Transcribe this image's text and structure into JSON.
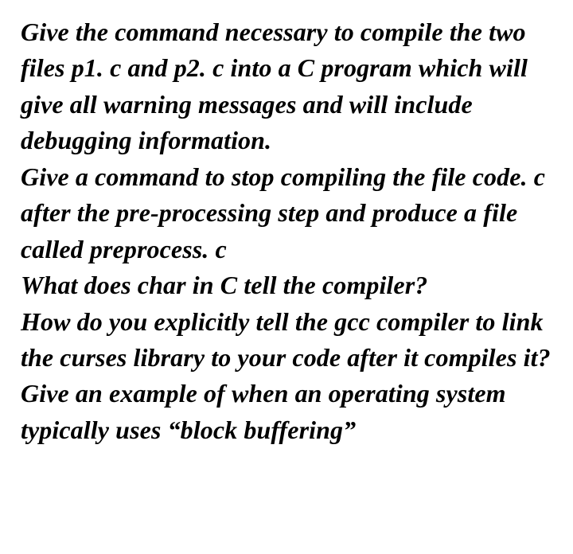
{
  "paragraphs": [
    "Give the command necessary to compile the two files p1. c and p2. c into a C program which will give all warning messages and will include debugging information.",
    "Give a command to stop compiling the file code. c after the pre-processing step and produce a file called preprocess. c",
    "What does char in C tell the compiler?",
    "How do you explicitly tell the gcc compiler to link the curses library to your code after it compiles it?",
    "Give an example of when an operating system typically uses “block buffering”"
  ]
}
